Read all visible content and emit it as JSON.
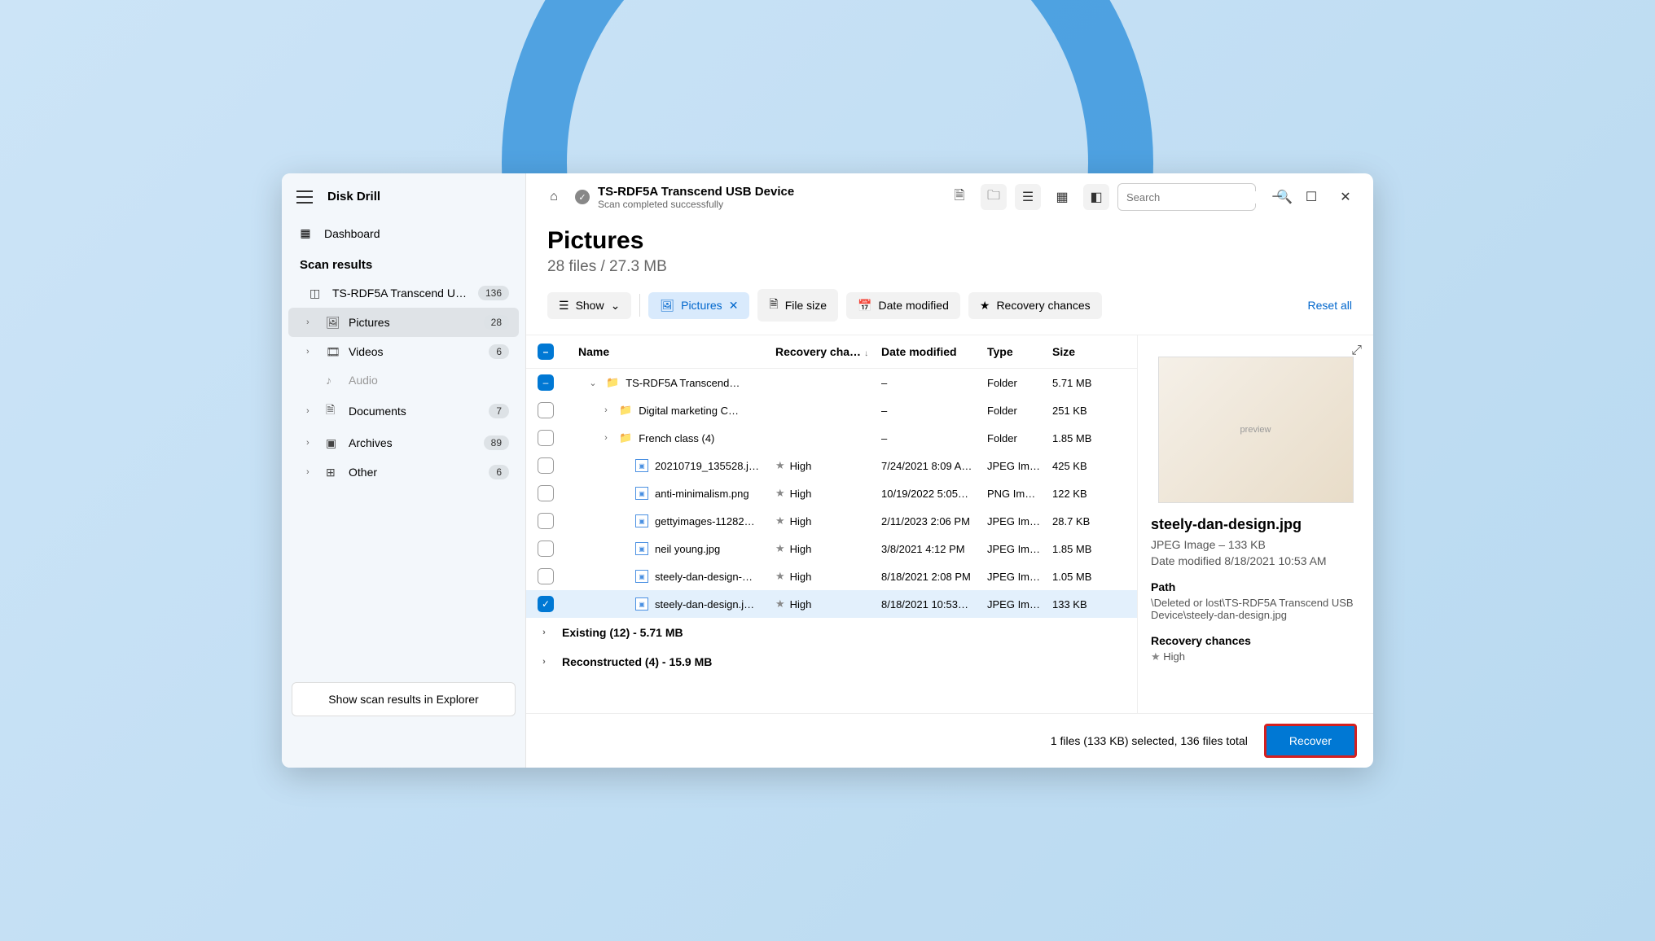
{
  "app": {
    "title": "Disk Drill"
  },
  "nav": {
    "dashboard": "Dashboard"
  },
  "scan": {
    "heading": "Scan results",
    "device": {
      "label": "TS-RDF5A Transcend US…",
      "count": "136"
    },
    "categories": [
      {
        "label": "Pictures",
        "count": "28",
        "active": true
      },
      {
        "label": "Videos",
        "count": "6"
      },
      {
        "label": "Audio",
        "disabled": true
      },
      {
        "label": "Documents",
        "count": "7"
      },
      {
        "label": "Archives",
        "count": "89"
      },
      {
        "label": "Other",
        "count": "6"
      }
    ]
  },
  "explorer_btn": "Show scan results in Explorer",
  "header": {
    "title": "TS-RDF5A Transcend USB Device",
    "subtitle": "Scan completed successfully"
  },
  "search": {
    "placeholder": "Search"
  },
  "content": {
    "title": "Pictures",
    "subtitle": "28 files / 27.3 MB"
  },
  "filters": {
    "show": "Show",
    "pictures": "Pictures",
    "filesize": "File size",
    "datemod": "Date modified",
    "reccha": "Recovery chances",
    "reset": "Reset all"
  },
  "columns": {
    "name": "Name",
    "recovery": "Recovery cha…",
    "date": "Date modified",
    "type": "Type",
    "size": "Size"
  },
  "rows": [
    {
      "indent": 1,
      "caret": "down",
      "icon": "folder",
      "name": "TS-RDF5A Transcend…",
      "rec": "",
      "date": "–",
      "type": "Folder",
      "size": "5.71 MB",
      "chk": "blue-dash"
    },
    {
      "indent": 2,
      "caret": "right",
      "icon": "folder",
      "name": "Digital marketing C…",
      "rec": "",
      "date": "–",
      "type": "Folder",
      "size": "251 KB",
      "chk": "empty"
    },
    {
      "indent": 2,
      "caret": "right",
      "icon": "folder",
      "name": "French class (4)",
      "rec": "",
      "date": "–",
      "type": "Folder",
      "size": "1.85 MB",
      "chk": "empty"
    },
    {
      "indent": 3,
      "icon": "file",
      "name": "20210719_135528.j…",
      "rec": "High",
      "date": "7/24/2021 8:09 A…",
      "type": "JPEG Im…",
      "size": "425 KB",
      "chk": "empty"
    },
    {
      "indent": 3,
      "icon": "file",
      "name": "anti-minimalism.png",
      "rec": "High",
      "date": "10/19/2022 5:05…",
      "type": "PNG Im…",
      "size": "122 KB",
      "chk": "empty"
    },
    {
      "indent": 3,
      "icon": "file",
      "name": "gettyimages-11282…",
      "rec": "High",
      "date": "2/11/2023 2:06 PM",
      "type": "JPEG Im…",
      "size": "28.7 KB",
      "chk": "empty"
    },
    {
      "indent": 3,
      "icon": "file",
      "name": "neil young.jpg",
      "rec": "High",
      "date": "3/8/2021 4:12 PM",
      "type": "JPEG Im…",
      "size": "1.85 MB",
      "chk": "empty"
    },
    {
      "indent": 3,
      "icon": "file",
      "name": "steely-dan-design-…",
      "rec": "High",
      "date": "8/18/2021 2:08 PM",
      "type": "JPEG Im…",
      "size": "1.05 MB",
      "chk": "empty"
    },
    {
      "indent": 3,
      "icon": "file",
      "name": "steely-dan-design.j…",
      "rec": "High",
      "date": "8/18/2021 10:53…",
      "type": "JPEG Im…",
      "size": "133 KB",
      "chk": "blue-check",
      "selected": true
    }
  ],
  "groups": [
    {
      "label": "Existing (12) - 5.71 MB"
    },
    {
      "label": "Reconstructed (4) - 15.9 MB"
    }
  ],
  "preview": {
    "filename": "steely-dan-design.jpg",
    "meta1": "JPEG Image – 133 KB",
    "meta2": "Date modified 8/18/2021 10:53 AM",
    "path_label": "Path",
    "path": "\\Deleted or lost\\TS-RDF5A Transcend USB Device\\steely-dan-design.jpg",
    "rec_label": "Recovery chances",
    "rec_value": "High"
  },
  "footer": {
    "status": "1 files (133 KB) selected, 136 files total",
    "recover": "Recover"
  }
}
